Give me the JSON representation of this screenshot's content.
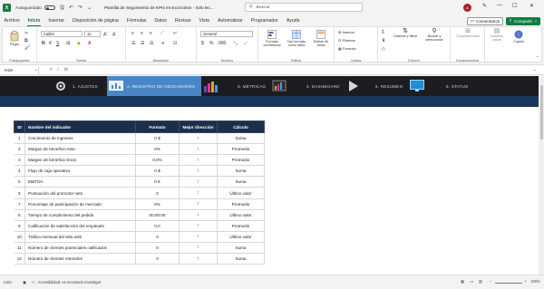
{
  "titlebar": {
    "autosave_label": "Autoguardado",
    "doc_title": "Plantilla de Seguimiento de KPIs en Excel.xlsm  ·  Solo lec...",
    "search_placeholder": "Buscar",
    "avatar_initial": "A",
    "win_min": "—",
    "win_max": "☐",
    "win_close": "✕"
  },
  "tabs": [
    "Archivo",
    "Inicio",
    "Insertar",
    "Disposición de página",
    "Fórmulas",
    "Datos",
    "Revisar",
    "Vista",
    "Automatizar",
    "Programador",
    "Ayuda"
  ],
  "active_tab": "Inicio",
  "buttons": {
    "comments": "Comentarios",
    "share": "Compartir"
  },
  "ribbon": {
    "paste": "Pegar",
    "clipboard": "Portapapeles",
    "font_name": "Calibri",
    "font_size": "11",
    "font_group": "Fuente",
    "align_group": "Alineación",
    "number_format": "General",
    "number_group": "Número",
    "cond_format": "Formato condicional",
    "table_format": "Dar formato como tabla",
    "cell_styles": "Estilos de celda",
    "styles_group": "Estilos",
    "insert": "Insertar",
    "delete": "Eliminar",
    "format": "Formato",
    "cells_group": "Celdas",
    "sort": "Ordenar y filtrar",
    "find": "Buscar y seleccionar",
    "edit_group": "Edición",
    "addins": "Complementos",
    "addins_group": "Complementos",
    "analyze": "Analizar datos",
    "copilot": "Copilot"
  },
  "formula_bar": {
    "cell_ref": "H19",
    "fx": "fx",
    "content": ""
  },
  "nav": [
    {
      "num": "1.",
      "label": "AJUSTES"
    },
    {
      "num": "2.",
      "label": "REGISTRO DE INDICADORES"
    },
    {
      "num": "3.",
      "label": "MÉTRICAS"
    },
    {
      "num": "4.",
      "label": "DASHBOARD"
    },
    {
      "num": "5.",
      "label": "RESUMEN"
    },
    {
      "num": "6.",
      "label": "STATUS"
    }
  ],
  "table": {
    "headers": [
      "ID",
      "Nombre del indicador",
      "Formato",
      "Mejor dirección",
      "Cálculo"
    ],
    "rows": [
      {
        "id": "1",
        "name": "Crecimiento de ingresos",
        "format": "0 $",
        "dir": "↑",
        "calc": "Suma"
      },
      {
        "id": "2",
        "name": "Margen de beneficio neto",
        "format": "0%",
        "dir": "↑",
        "calc": "Promedio"
      },
      {
        "id": "3",
        "name": "Margen de beneficio bruto",
        "format": "0,0%",
        "dir": "↑",
        "calc": "Promedio"
      },
      {
        "id": "4",
        "name": "Flujo de caja operativo",
        "format": "0 $",
        "dir": "↑",
        "calc": "Suma"
      },
      {
        "id": "5",
        "name": "EBITDA",
        "format": "0 €",
        "dir": "↑",
        "calc": "Suma"
      },
      {
        "id": "6",
        "name": "Puntuación del promotor neto",
        "format": "0",
        "dir": "↑",
        "calc": "Último valor"
      },
      {
        "id": "7",
        "name": "Porcentaje de participación de mercado",
        "format": "0%",
        "dir": "↑",
        "calc": "Promedio"
      },
      {
        "id": "8",
        "name": "Tiempo de cumplimiento del pedido",
        "format": "00:00:00",
        "dir": "↓",
        "calc": "Último valor"
      },
      {
        "id": "9",
        "name": "Calificación de satisfacción del empleado",
        "format": "0,0",
        "dir": "↑",
        "calc": "Promedio"
      },
      {
        "id": "10",
        "name": "Tráfico mensual del sitio web",
        "format": "0",
        "dir": "↑",
        "calc": "Último valor"
      },
      {
        "id": "11",
        "name": "Número de clientes potenciales calificados",
        "format": "0",
        "dir": "↑",
        "calc": "Suma"
      },
      {
        "id": "12",
        "name": "Número de clientes retenidos",
        "format": "0",
        "dir": "↑",
        "calc": "Suma"
      }
    ]
  },
  "statusbar": {
    "ready": "Listo",
    "accessibility": "Accesibilidad: es necesario investigar",
    "zoom": "100%"
  }
}
